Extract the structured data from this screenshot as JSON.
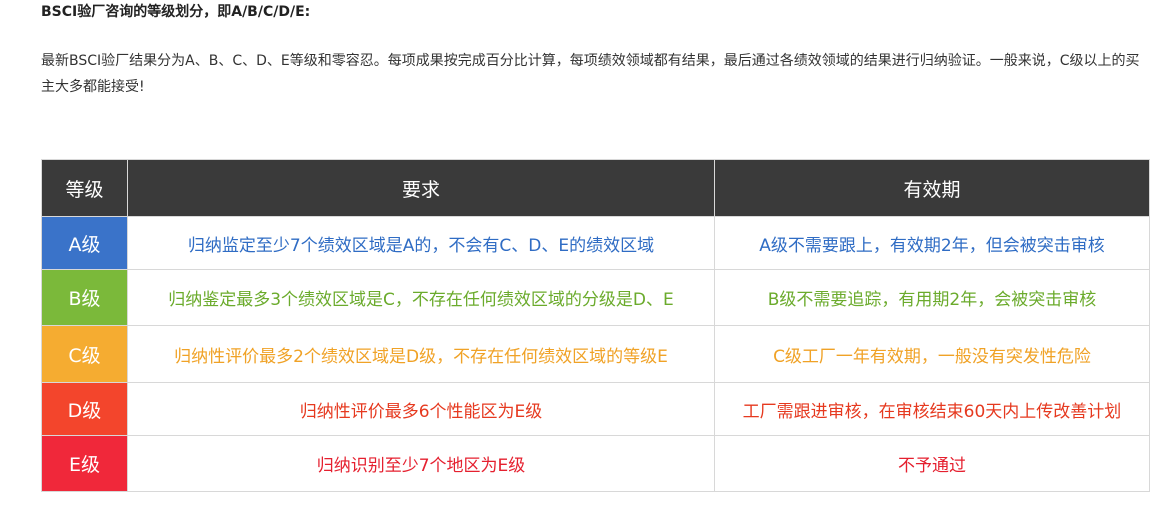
{
  "heading": "BSCI验厂咨询的等级划分，即A/B/C/D/E:",
  "intro": "最新BSCI验厂结果分为A、B、C、D、E等级和零容忍。每项成果按完成百分比计算，每项绩效领域都有结果，最后通过各绩效领域的结果进行归纳验证。一般来说，C级以上的买主大多都能接受!",
  "table": {
    "headers": [
      "等级",
      "要求",
      "有效期"
    ],
    "header_bg": "#3a3a3a",
    "rows": [
      {
        "grade": "A级",
        "requirement": "归纳监定至少7个绩效区域是A的，不会有C、D、E的绩效区域",
        "validity": "A级不需要跟上，有效期2年，但会被突击审核",
        "grade_color": "#3a73c9",
        "text_color": "#2f6cc4"
      },
      {
        "grade": "B级",
        "requirement": "归纳鉴定最多3个绩效区域是C，不存在任何绩效区域的分级是D、E",
        "validity": "B级不需要追踪，有用期2年，会被突击审核",
        "grade_color": "#7bb93a",
        "text_color": "#6bab2c"
      },
      {
        "grade": "C级",
        "requirement": "归纳性评价最多2个绩效区域是D级，不存在任何绩效区域的等级E",
        "validity": "C级工厂一年有效期，一般没有突发性危险",
        "grade_color": "#f5ac31",
        "text_color": "#f0a226"
      },
      {
        "grade": "D级",
        "requirement": "归纳性评价最多6个性能区为E级",
        "validity": "工厂需跟进审核，在审核结束60天内上传改善计划",
        "grade_color": "#f3452c",
        "text_color": "#e6391f"
      },
      {
        "grade": "E级",
        "requirement": "归纳识别至少7个地区为E级",
        "validity": "不予通过",
        "grade_color": "#f0283a",
        "text_color": "#e5202f"
      }
    ]
  }
}
